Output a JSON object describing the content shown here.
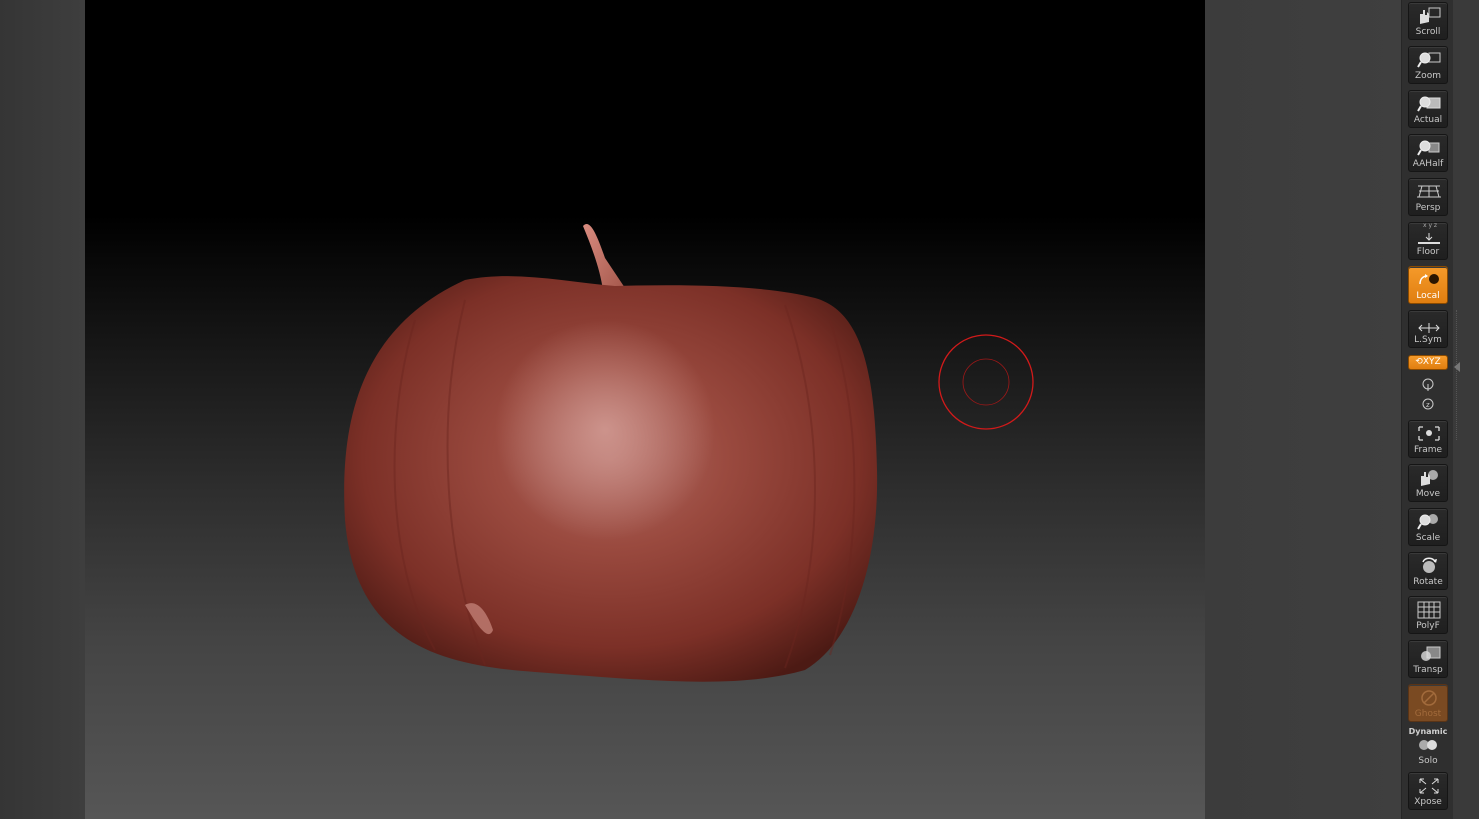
{
  "viewport": {
    "brush_cursor_color": "#d11a1a",
    "model": "red pumpkin sculpt",
    "model_color": "#8a3b30"
  },
  "shelf": {
    "scroll": {
      "label": "Scroll",
      "icon": "hand-scroll-icon"
    },
    "zoom": {
      "label": "Zoom",
      "icon": "magnifier-zoom-icon"
    },
    "actual": {
      "label": "Actual",
      "icon": "magnifier-actual-icon"
    },
    "aahalf": {
      "label": "AAHalf",
      "icon": "magnifier-aahalf-icon"
    },
    "persp": {
      "label": "Persp",
      "icon": "perspective-grid-icon"
    },
    "floor": {
      "label": "Floor",
      "icon": "floor-grid-icon",
      "axis_marks": "x y z"
    },
    "local": {
      "label": "Local",
      "icon": "local-transform-icon",
      "active": true
    },
    "lsym": {
      "label": "L.Sym",
      "icon": "local-symmetry-icon"
    },
    "xyz": {
      "label": "XYZ",
      "icon": "rotation-axis-icon",
      "active": true
    },
    "frame": {
      "label": "Frame",
      "icon": "frame-icon"
    },
    "move": {
      "label": "Move",
      "icon": "hand-move-icon"
    },
    "scale": {
      "label": "Scale",
      "icon": "magnifier-scale-icon"
    },
    "rotate": {
      "label": "Rotate",
      "icon": "rotate-icon"
    },
    "polyf": {
      "label": "PolyF",
      "icon": "polyframe-grid-icon"
    },
    "transp": {
      "label": "Transp",
      "icon": "transparency-icon"
    },
    "ghost": {
      "label": "Ghost",
      "icon": "ghost-icon"
    },
    "dynamic": {
      "label": "Dynamic"
    },
    "solo": {
      "label": "Solo",
      "icon": "solo-spheres-icon"
    },
    "xpose": {
      "label": "Xpose",
      "icon": "xpose-arrows-icon"
    }
  }
}
